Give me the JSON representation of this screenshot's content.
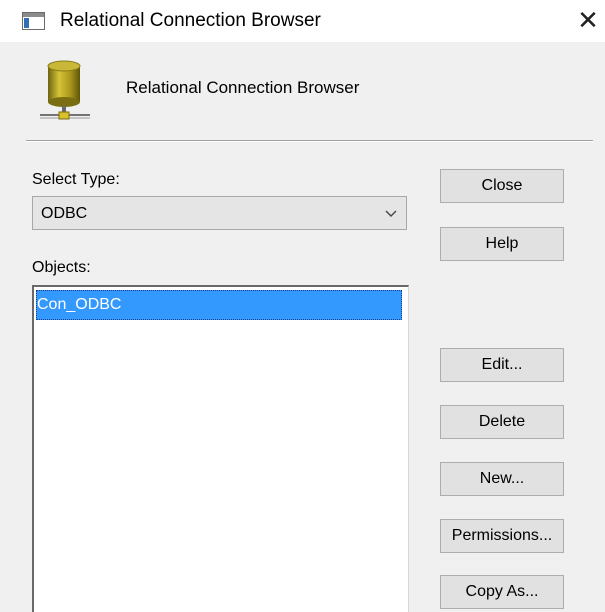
{
  "window": {
    "title": "Relational Connection Browser",
    "close_glyph": "✕",
    "title_icon": "window-app-icon"
  },
  "header": {
    "title": "Relational Connection Browser",
    "icon": "database-icon"
  },
  "select_type": {
    "label": "Select Type:",
    "value": "ODBC"
  },
  "objects": {
    "label": "Objects:",
    "items": [
      {
        "label": "Con_ODBC",
        "selected": true
      }
    ]
  },
  "buttons": {
    "close": "Close",
    "help": "Help",
    "edit": "Edit...",
    "delete": "Delete",
    "new": "New...",
    "permissions": "Permissions...",
    "copy_as": "Copy As..."
  },
  "colors": {
    "selection": "#3399ff",
    "dialog_bg": "#f0f0f0",
    "button_bg": "#e1e1e1",
    "database_gold": "#b5a020"
  }
}
